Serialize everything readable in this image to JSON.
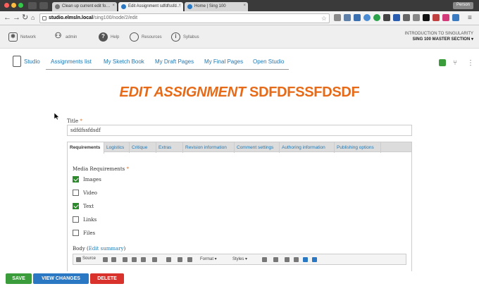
{
  "browser": {
    "tabs": [
      {
        "label": "Clean up current edit fo…",
        "active": false
      },
      {
        "label": "Edit Assignment sdfdfssfd…",
        "active": true
      },
      {
        "label": "Home | Sing 100",
        "active": false
      }
    ],
    "user_badge": "Person",
    "url_host": "studio.elmsln.local",
    "url_path": "/sing100/node/2/edit"
  },
  "header": {
    "items": [
      {
        "label": "Network",
        "icon": "network-icon"
      },
      {
        "label": "admin",
        "icon": "user-icon"
      },
      {
        "label": "Help",
        "icon": "help-icon"
      },
      {
        "label": "Resources",
        "icon": "resources-icon"
      },
      {
        "label": "Syllabus",
        "icon": "info-icon"
      }
    ],
    "course": "INTRODUCTION TO SINGULARITY",
    "section": "SING 100 MASTER SECTION"
  },
  "subnav": {
    "brand": "Studio",
    "links": [
      "Assignments list",
      "My Sketch Book",
      "My Draft Pages",
      "My Final Pages",
      "Open Studio"
    ]
  },
  "page": {
    "title_prefix": "EDIT ASSIGNMENT",
    "title_name": "SDFDFSSFDSDF"
  },
  "form": {
    "title_label": "Title",
    "required_mark": "*",
    "title_value": "sdfdfssfdsdf",
    "tabs": [
      "Requirements",
      "Logistics",
      "Critique",
      "Extras",
      "Revision information",
      "Comment settings",
      "Authoring information",
      "Publishing options"
    ],
    "media_label": "Media Requirements",
    "media_options": [
      {
        "label": "Images",
        "checked": true
      },
      {
        "label": "Video",
        "checked": false
      },
      {
        "label": "Text",
        "checked": true
      },
      {
        "label": "Links",
        "checked": false
      },
      {
        "label": "Files",
        "checked": false
      }
    ],
    "body_label": "Body",
    "body_link": "Edit summary",
    "editor": {
      "source": "Source",
      "format": "Format",
      "styles": "Styles"
    }
  },
  "actions": {
    "save": "SAVE",
    "view_changes": "VIEW CHANGES",
    "delete": "DELETE"
  },
  "colors": {
    "accent_orange": "#e66a17",
    "link_blue": "#1f78b4",
    "save_green": "#3a9c3a",
    "view_blue": "#2a78c4",
    "delete_red": "#d9312b"
  }
}
